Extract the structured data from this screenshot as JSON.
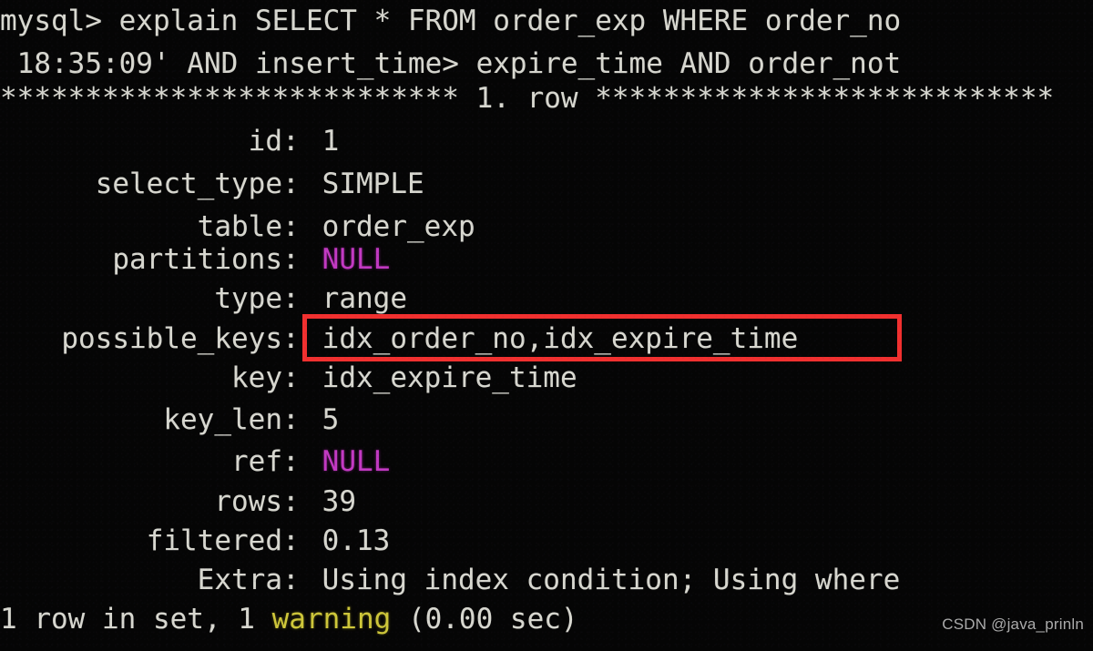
{
  "terminal": {
    "background_color": "#050505",
    "foreground_color": "#d8d8d0",
    "prompt_line": "mysql> explain SELECT * FROM order_exp WHERE order_no",
    "wrapped_query_line": " 18:35:09' AND insert_time> expire_time AND order_not",
    "row_divider": "*************************** 1. row ***************************",
    "footer": "1 row in set, 1 ",
    "footer_warning_word": "warning",
    "footer_tail": " (0.00 sec)",
    "explain_rows": [
      {
        "label": "id",
        "value": "1"
      },
      {
        "label": "select_type",
        "value": "SIMPLE"
      },
      {
        "label": "table",
        "value": "order_exp"
      },
      {
        "label": "partitions",
        "value": "NULL"
      },
      {
        "label": "type",
        "value": "range"
      },
      {
        "label": "possible_keys",
        "value": "idx_order_no,idx_expire_time"
      },
      {
        "label": "key",
        "value": "idx_expire_time"
      },
      {
        "label": "key_len",
        "value": "5"
      },
      {
        "label": "ref",
        "value": "NULL"
      },
      {
        "label": "rows",
        "value": "39"
      },
      {
        "label": "filtered",
        "value": "0.13"
      },
      {
        "label": "Extra",
        "value": "Using index condition; Using where"
      }
    ],
    "colon": ":",
    "annotation": {
      "type": "rectangle-highlight",
      "color": "#f2302f",
      "target_field": "possible_keys"
    },
    "watermark": "CSDN @java_prinln",
    "value_colors": {
      "null": "#c33ac3",
      "warning": "#cfc83a"
    }
  }
}
